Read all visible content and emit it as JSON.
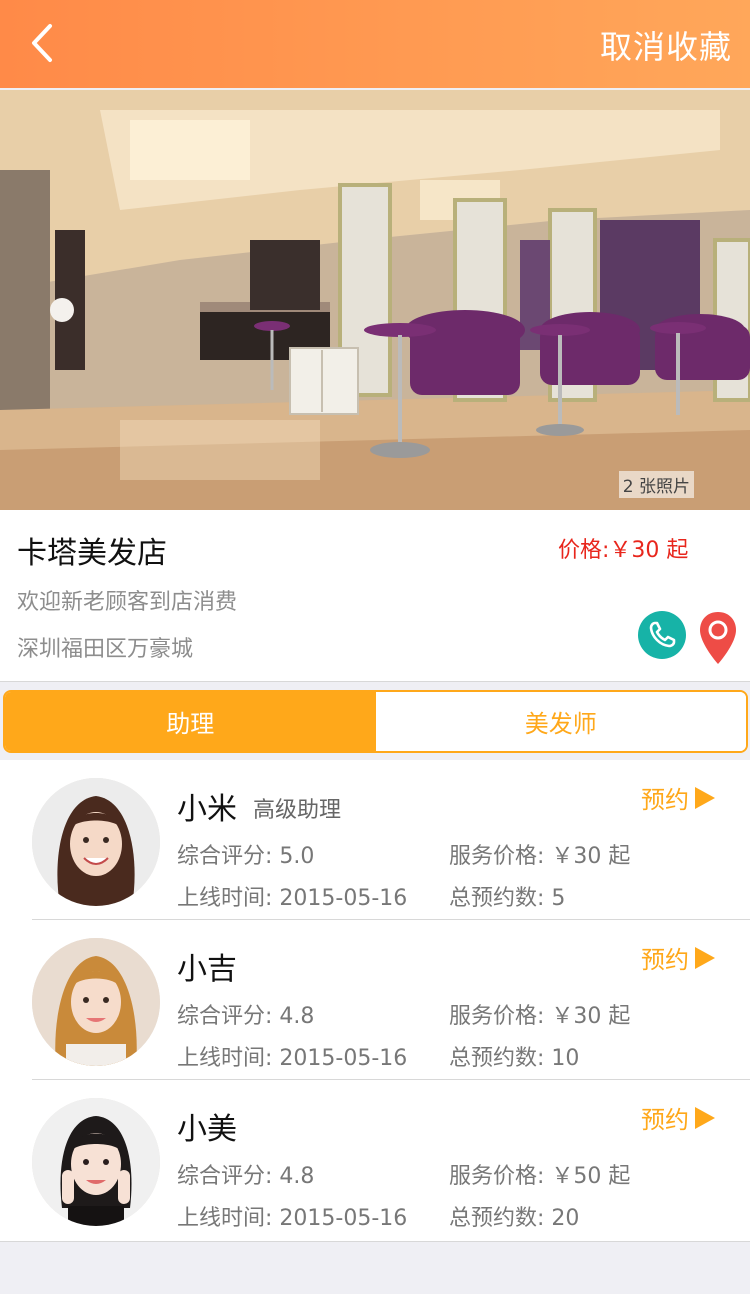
{
  "nav": {
    "cancel_favorite": "取消收藏"
  },
  "hero": {
    "photo_count": "2 张照片"
  },
  "shop": {
    "name": "卡塔美发店",
    "price": "价格:￥30 起",
    "desc": "欢迎新老顾客到店消费",
    "address": "深圳福田区万豪城"
  },
  "tabs": [
    {
      "label": "助理",
      "active": true
    },
    {
      "label": "美发师",
      "active": false
    }
  ],
  "staff": [
    {
      "name": "小米",
      "role": "高级助理",
      "rating_label": "综合评分:",
      "rating": "5.0",
      "price_label": "服务价格:",
      "price": "￥30 起",
      "online_label": "上线时间:",
      "online": "2015-05-16",
      "count_label": "总预约数:",
      "count": "5",
      "book": "预约"
    },
    {
      "name": "小吉",
      "role": "",
      "rating_label": "综合评分:",
      "rating": "4.8",
      "price_label": "服务价格:",
      "price": "￥30 起",
      "online_label": "上线时间:",
      "online": "2015-05-16",
      "count_label": "总预约数:",
      "count": "10",
      "book": "预约"
    },
    {
      "name": "小美",
      "role": "",
      "rating_label": "综合评分:",
      "rating": "4.8",
      "price_label": "服务价格:",
      "price": "￥50 起",
      "online_label": "上线时间:",
      "online": "2015-05-16",
      "count_label": "总预约数:",
      "count": "20",
      "book": "预约"
    }
  ],
  "colors": {
    "nav_start": "#ff8a48",
    "nav_end": "#ffa75a",
    "accent": "#ffa81a",
    "price_red": "#e8261c",
    "phone_teal": "#17b3a7",
    "map_red": "#ee4c46"
  }
}
